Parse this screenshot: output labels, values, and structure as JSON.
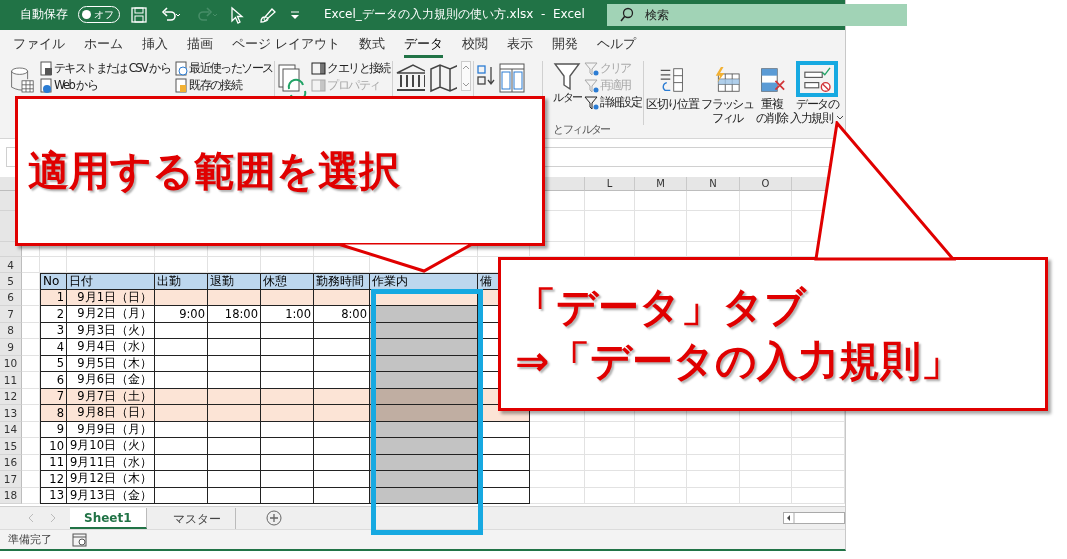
{
  "title_bar": {
    "autosave_label": "自動保存",
    "autosave_toggle": {
      "label": "オフ",
      "on": false
    },
    "quick_access": [
      {
        "kind": "save",
        "disabled": false
      },
      {
        "kind": "undo",
        "disabled": false
      },
      {
        "kind": "redo",
        "disabled": true
      },
      {
        "kind": "pointer",
        "disabled": false
      },
      {
        "kind": "brush",
        "disabled": false
      },
      {
        "kind": "customize",
        "disabled": false
      }
    ],
    "title": "Excel_データの入力規則の使い方.xlsx  -  Excel",
    "search": {
      "placeholder": "検索"
    }
  },
  "ribbon_tabs": [
    {
      "label": "ファイル",
      "selected": false
    },
    {
      "label": "ホーム",
      "selected": false
    },
    {
      "label": "挿入",
      "selected": false
    },
    {
      "label": "描画",
      "selected": false
    },
    {
      "label": "ページ レイアウト",
      "selected": false
    },
    {
      "label": "数式",
      "selected": false
    },
    {
      "label": "データ",
      "selected": true
    },
    {
      "label": "校閲",
      "selected": false
    },
    {
      "label": "表示",
      "selected": false
    },
    {
      "label": "開発",
      "selected": false
    },
    {
      "label": "ヘルプ",
      "selected": false
    }
  ],
  "ribbon": {
    "get_data": {
      "items": [
        {
          "label": "テキストまたは CSV から"
        },
        {
          "label": "Web から"
        },
        {
          "label": "最近使ったソース"
        },
        {
          "label": "既存の接続"
        }
      ]
    },
    "queries": {
      "items": [
        {
          "label": "クエリと接続",
          "disabled": false
        },
        {
          "label": "プロパティ",
          "disabled": true
        }
      ]
    },
    "sort_filter": {
      "filter_label": "ルター",
      "group_label": "とフィルター",
      "items": [
        {
          "label": "クリア",
          "disabled": true
        },
        {
          "label": "再適用",
          "disabled": true
        },
        {
          "label": "詳細設定",
          "disabled": false
        }
      ]
    },
    "data_tools": {
      "items": [
        {
          "lines": [
            "区切り位置"
          ],
          "dropdown": false,
          "highlighted": false
        },
        {
          "lines": [
            "フラッシュ",
            "フィル"
          ],
          "dropdown": false,
          "highlighted": false
        },
        {
          "lines": [
            "重複",
            "の削除"
          ],
          "dropdown": false,
          "highlighted": false
        },
        {
          "lines": [
            "データの",
            "入力規則"
          ],
          "dropdown": true,
          "highlighted": true
        }
      ]
    }
  },
  "sheet": {
    "column_headers": [
      "L",
      "M",
      "N",
      "O"
    ],
    "row_numbers": [
      "4",
      "5",
      "6",
      "7",
      "8",
      "9",
      "10",
      "11",
      "12",
      "13",
      "14",
      "15",
      "16",
      "17",
      "18"
    ],
    "table": {
      "columns": [
        {
          "label": "No",
          "selected": false
        },
        {
          "label": "日付",
          "selected": false
        },
        {
          "label": "出勤",
          "selected": false
        },
        {
          "label": "退勤",
          "selected": false
        },
        {
          "label": "休憩",
          "selected": false
        },
        {
          "label": "勤務時間",
          "selected": false
        },
        {
          "label": "作業内",
          "selected": true
        },
        {
          "label": "備",
          "selected": false
        }
      ],
      "rows": [
        {
          "no": "1",
          "date": "9月1日（日）",
          "holiday": true,
          "active": true
        },
        {
          "no": "2",
          "date": "9月2日（月）",
          "holiday": false,
          "active": false,
          "times": [
            "9:00",
            "18:00",
            "1:00",
            "8:00"
          ]
        },
        {
          "no": "3",
          "date": "9月3日（火）",
          "holiday": false,
          "active": false
        },
        {
          "no": "4",
          "date": "9月4日（水）",
          "holiday": false,
          "active": false
        },
        {
          "no": "5",
          "date": "9月5日（木）",
          "holiday": false,
          "active": false
        },
        {
          "no": "6",
          "date": "9月6日（金）",
          "holiday": false,
          "active": false
        },
        {
          "no": "7",
          "date": "9月7日（土）",
          "holiday": true,
          "active": false
        },
        {
          "no": "8",
          "date": "9月8日（日）",
          "holiday": true,
          "active": false
        },
        {
          "no": "9",
          "date": "9月9日（月）",
          "holiday": false,
          "active": false
        },
        {
          "no": "10",
          "date": "9月10日（火）",
          "holiday": false,
          "active": false
        },
        {
          "no": "11",
          "date": "9月11日（水）",
          "holiday": false,
          "active": false
        },
        {
          "no": "12",
          "date": "9月12日（木）",
          "holiday": false,
          "active": false
        },
        {
          "no": "13",
          "date": "9月13日（金）",
          "holiday": false,
          "active": false
        }
      ]
    }
  },
  "sheet_tabs": [
    {
      "label": "Sheet1",
      "selected": true
    },
    {
      "label": "マスター",
      "selected": false
    }
  ],
  "status_bar": {
    "text": "準備完了"
  },
  "callouts": [
    {
      "lines": [
        "適用する範囲を選択"
      ]
    },
    {
      "lines": [
        "「データ」タブ",
        "⇒「データの入力規則」"
      ]
    }
  ]
}
